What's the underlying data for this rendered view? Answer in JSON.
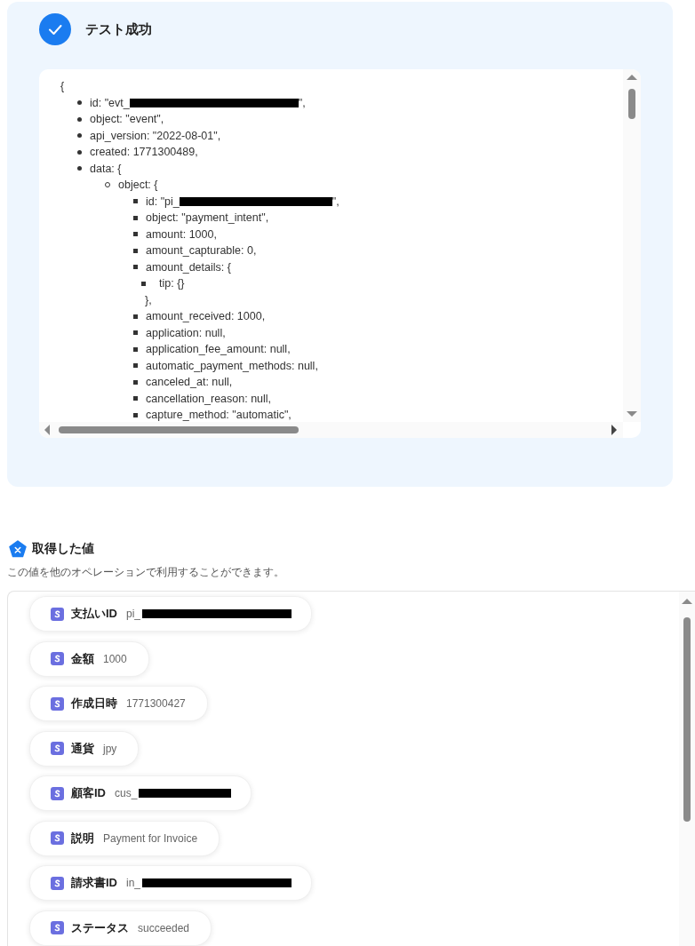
{
  "result": {
    "title": "テスト成功",
    "code_open": "{",
    "code_lines": [
      {
        "text": "id: \"evt_",
        "redacted": true,
        "after": "\","
      },
      {
        "text": "object: \"event\","
      },
      {
        "text": "api_version: \"2022-08-01\","
      },
      {
        "text": "created: 1771300489,"
      },
      {
        "text": "data: {",
        "children": [
          {
            "text": "object: {",
            "children": [
              {
                "text": "id: \"pi_",
                "redacted": true,
                "after": "\","
              },
              {
                "text": "object: \"payment_intent\","
              },
              {
                "text": "amount: 1000,"
              },
              {
                "text": "amount_capturable: 0,"
              },
              {
                "text": "amount_details: {",
                "children": [
                  {
                    "text": "tip: {}"
                  }
                ],
                "close": "},"
              },
              {
                "text": "amount_received: 1000,"
              },
              {
                "text": "application: null,"
              },
              {
                "text": "application_fee_amount: null,"
              },
              {
                "text": "automatic_payment_methods: null,"
              },
              {
                "text": "canceled_at: null,"
              },
              {
                "text": "cancellation_reason: null,"
              },
              {
                "text": "capture_method: \"automatic\","
              }
            ]
          }
        ]
      }
    ]
  },
  "values": {
    "title": "取得した値",
    "description": "この値を他のオペレーションで利用することができます。",
    "items": [
      {
        "label": "支払いID",
        "value": "pi_",
        "redacted": true
      },
      {
        "label": "金額",
        "value": "1000"
      },
      {
        "label": "作成日時",
        "value": "1771300427"
      },
      {
        "label": "通貨",
        "value": "jpy"
      },
      {
        "label": "顧客ID",
        "value": "cus_",
        "redacted": true
      },
      {
        "label": "説明",
        "value": "Payment for Invoice"
      },
      {
        "label": "請求書ID",
        "value": "in_",
        "redacted": true
      },
      {
        "label": "ステータス",
        "value": "succeeded"
      }
    ]
  }
}
